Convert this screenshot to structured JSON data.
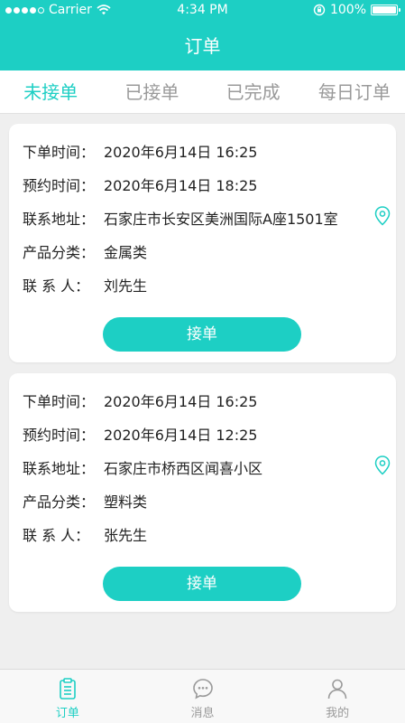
{
  "status_bar": {
    "carrier": "Carrier",
    "time": "4:34 PM",
    "battery": "100%"
  },
  "navbar": {
    "title": "订单"
  },
  "tabs": [
    {
      "label": "未接单",
      "active": true
    },
    {
      "label": "已接单",
      "active": false
    },
    {
      "label": "已完成",
      "active": false
    },
    {
      "label": "每日订单",
      "active": false
    }
  ],
  "labels": {
    "order_time": "下单时间：",
    "appointment_time": "预约时间：",
    "address": "联系地址：",
    "category": "产品分类：",
    "contact": "联 系 人："
  },
  "orders": [
    {
      "order_time": "2020年6月14日 16:25",
      "appointment_time": "2020年6月14日 18:25",
      "address": "石家庄市长安区美洲国际A座1501室",
      "category": "金属类",
      "contact": "刘先生",
      "button": "接单"
    },
    {
      "order_time": "2020年6月14日 16:25",
      "appointment_time": "2020年6月14日 12:25",
      "address": "石家庄市桥西区闻喜小区",
      "category": "塑料类",
      "contact": "张先生",
      "button": "接单"
    }
  ],
  "tab_bar": [
    {
      "label": "订单",
      "icon": "clipboard-icon",
      "active": true
    },
    {
      "label": "消息",
      "icon": "chat-bubble-icon",
      "active": false
    },
    {
      "label": "我的",
      "icon": "person-icon",
      "active": false
    }
  ],
  "colors": {
    "accent": "#1dcfc4",
    "inactive": "#9a9a9a",
    "background": "#efefef"
  }
}
